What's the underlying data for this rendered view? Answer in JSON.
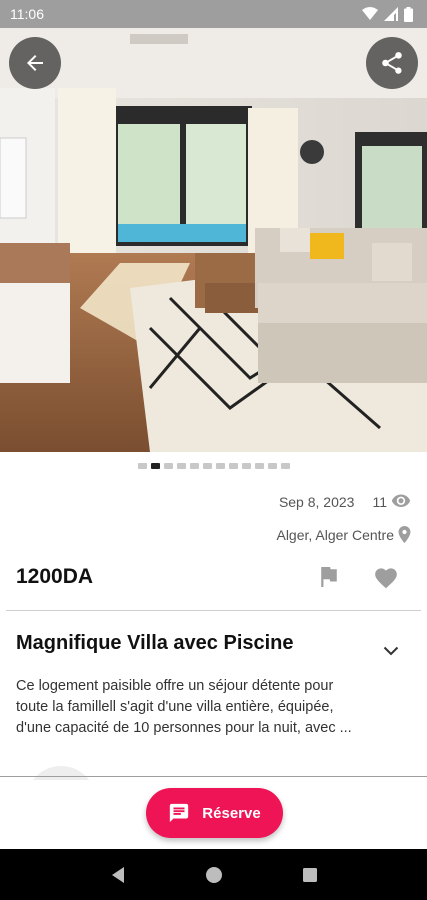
{
  "status_bar": {
    "time": "11:06",
    "icons": [
      "wifi-icon",
      "signal-icon",
      "battery-icon"
    ]
  },
  "hero": {
    "back_icon": "arrow-left-icon",
    "share_icon": "share-icon",
    "carousel_total": 12,
    "carousel_active_index": 1
  },
  "listing": {
    "date": "Sep 8, 2023",
    "views": "11",
    "location": "Alger, Alger Centre",
    "price": "1200DA",
    "title": "Magnifique Villa avec Piscine",
    "description_lines": [
      "Ce logement paisible offre un séjour détente pour",
      "toute la famillell s'agit d'une villa entière, équipée,",
      "d'une capacité de 10 personnes pour la nuit, avec ..."
    ]
  },
  "actions": {
    "reserve_label": "Réserve"
  },
  "colors": {
    "accent": "#ee1456",
    "status_bar": "#9e9e9e",
    "icon_gray": "#9e9e9e"
  }
}
